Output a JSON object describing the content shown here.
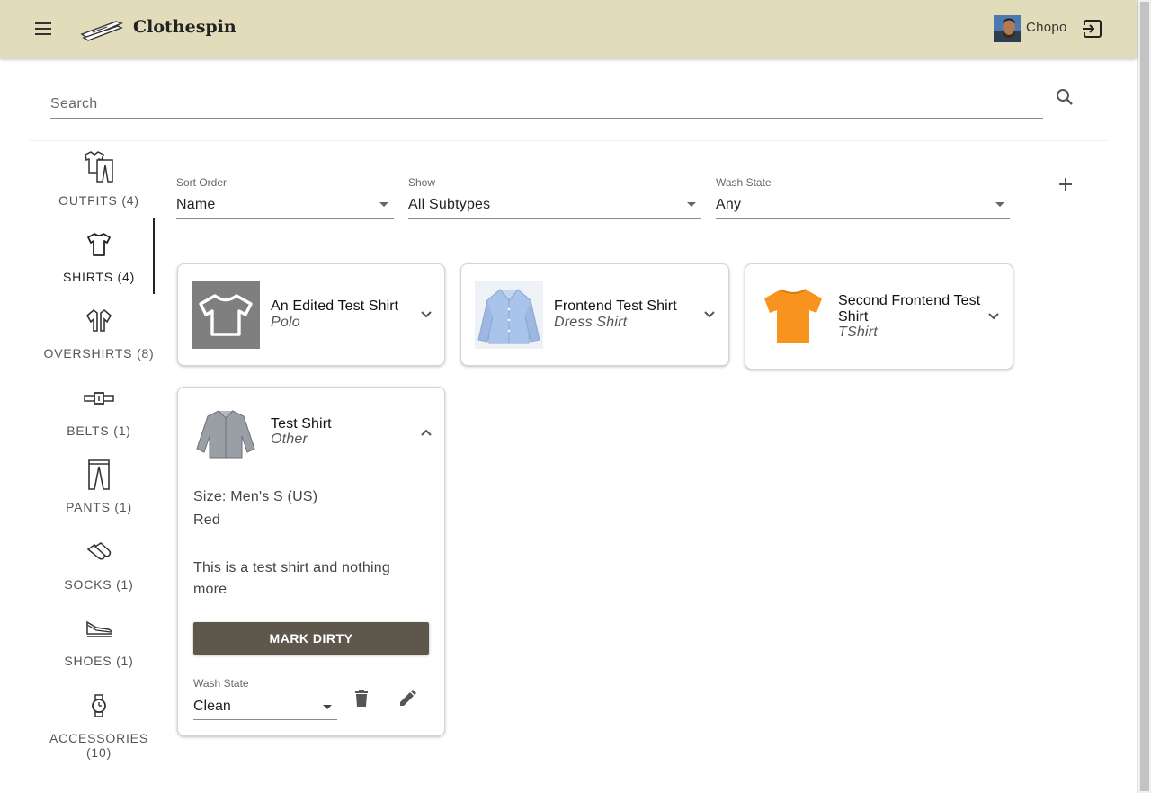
{
  "header": {
    "app_title": "Clothespin",
    "user_name": "Chopo"
  },
  "search": {
    "placeholder": "Search"
  },
  "nav": {
    "items": [
      {
        "label": "OUTFITS (4)",
        "icon": "outfit-icon"
      },
      {
        "label": "SHIRTS (4)",
        "icon": "shirt-icon",
        "active": true
      },
      {
        "label": "OVERSHIRTS (8)",
        "icon": "overshirt-icon"
      },
      {
        "label": "BELTS (1)",
        "icon": "belt-icon"
      },
      {
        "label": "PANTS (1)",
        "icon": "pants-icon"
      },
      {
        "label": "SOCKS (1)",
        "icon": "socks-icon"
      },
      {
        "label": "SHOES (1)",
        "icon": "shoe-icon"
      },
      {
        "label": "ACCESSORIES (10)",
        "icon": "watch-icon"
      }
    ]
  },
  "filters": {
    "sort_order": {
      "label": "Sort Order",
      "value": "Name"
    },
    "show": {
      "label": "Show",
      "value": "All Subtypes"
    },
    "wash_state": {
      "label": "Wash State",
      "value": "Any"
    }
  },
  "cards": [
    {
      "title": "An Edited Test Shirt",
      "subtype": "Polo"
    },
    {
      "title": "Frontend Test Shirt",
      "subtype": "Dress Shirt"
    },
    {
      "title": "Second Frontend Test Shirt",
      "subtype": "TShirt"
    },
    {
      "title": "Test Shirt",
      "subtype": "Other",
      "size": "Size: Men's S (US)",
      "color": "Red",
      "description": "This is a test shirt and nothing more",
      "mark_button": "MARK DIRTY",
      "wash_state_label": "Wash State",
      "wash_state_value": "Clean"
    }
  ],
  "colors": {
    "header_bg": "#e2dcbb",
    "button_bg": "#5d584b",
    "orange_shirt": "#f7931e",
    "dress_shirt": "#a9c4ea"
  }
}
